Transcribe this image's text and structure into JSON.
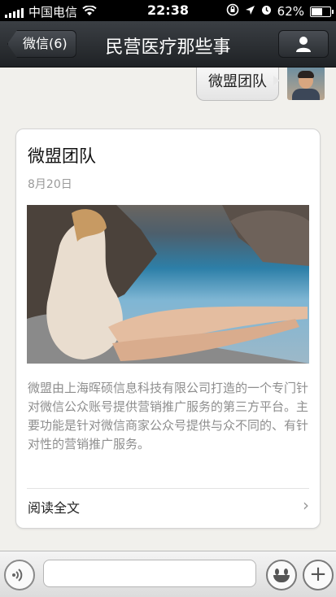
{
  "status_bar": {
    "carrier": "中国电信",
    "time": "22:38",
    "battery_percent": "62%",
    "battery_level": 0.62
  },
  "nav": {
    "back_label": "微信(6)",
    "title": "民营医疗那些事"
  },
  "chat": {
    "sent_message": "微盟团队",
    "article": {
      "title": "微盟团队",
      "date": "8月20日",
      "description": "微盟由上海晖硕信息科技有限公司打造的一个专门针对微信公众账号提供营销推广服务的第三方平台。主要功能是针对微信商家公众号提供与众不同的、有针对性的营销推广服务。",
      "read_more": "阅读全文"
    }
  },
  "input_bar": {
    "placeholder": ""
  },
  "icons": [
    "signal-icon",
    "wifi-icon",
    "orientation-lock-icon",
    "location-icon",
    "alarm-icon",
    "battery-icon",
    "person-icon",
    "voice-icon",
    "emoji-icon",
    "plus-icon",
    "chevron-right-icon"
  ]
}
